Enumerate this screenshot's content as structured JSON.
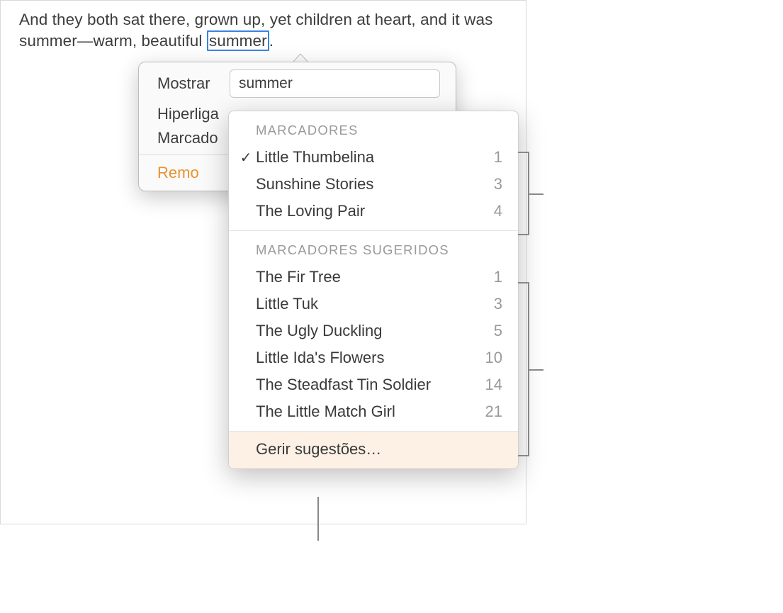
{
  "document": {
    "text_before": "And they both sat there, grown up, yet children at heart, and it was summer—warm, beautiful ",
    "selected_word": "summer",
    "text_after": "."
  },
  "popover": {
    "show_label": "Mostrar",
    "show_value": "summer",
    "hyperlink_label": "Hiperliga",
    "bookmark_label": "Marcado",
    "remove_label": "Remo"
  },
  "dropdown": {
    "section1_header": "MARCADORES",
    "section1_items": [
      {
        "label": "Little Thumbelina",
        "count": "1",
        "checked": true
      },
      {
        "label": "Sunshine Stories",
        "count": "3",
        "checked": false
      },
      {
        "label": "The Loving Pair",
        "count": "4",
        "checked": false
      }
    ],
    "section2_header": "MARCADORES SUGERIDOS",
    "section2_items": [
      {
        "label": "The Fir Tree",
        "count": "1"
      },
      {
        "label": "Little Tuk",
        "count": "3"
      },
      {
        "label": "The Ugly Duckling",
        "count": "5"
      },
      {
        "label": "Little Ida's Flowers",
        "count": "10"
      },
      {
        "label": "The Steadfast Tin Soldier",
        "count": "14"
      },
      {
        "label": "The Little Match Girl",
        "count": "21"
      }
    ],
    "footer_label": "Gerir sugestões…"
  }
}
